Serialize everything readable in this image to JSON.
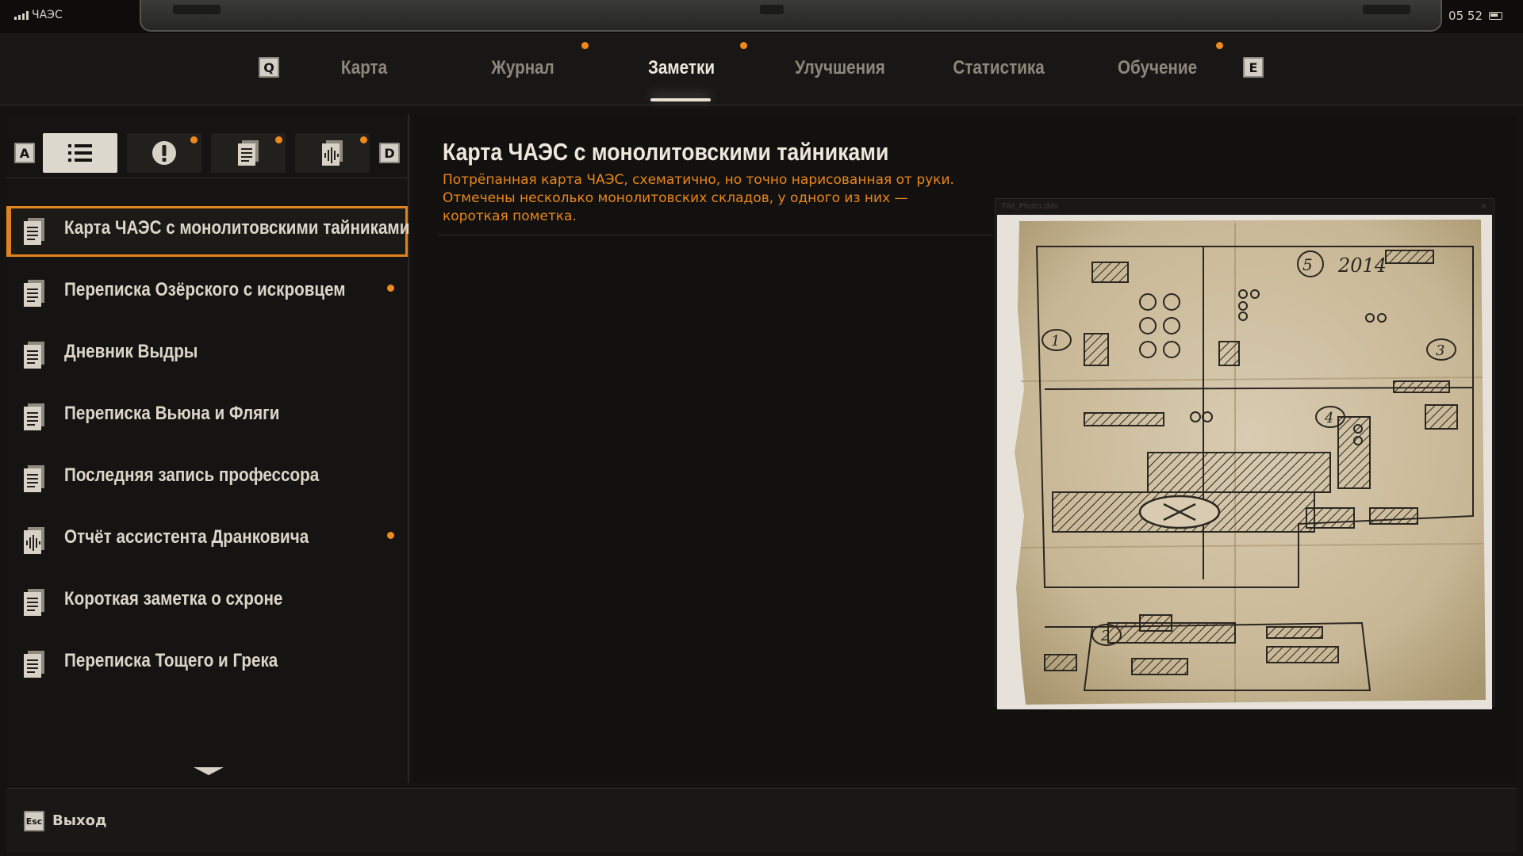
{
  "status": {
    "location": "ЧАЭС",
    "time": "05 52"
  },
  "tabs": {
    "prev_key": "Q",
    "next_key": "E",
    "items": [
      {
        "label": "Карта",
        "active": false,
        "badge": false
      },
      {
        "label": "Журнал",
        "active": false,
        "badge": true
      },
      {
        "label": "Заметки",
        "active": true,
        "badge": true
      },
      {
        "label": "Улучшения",
        "active": false,
        "badge": false
      },
      {
        "label": "Статистика",
        "active": false,
        "badge": false
      },
      {
        "label": "Обучение",
        "active": false,
        "badge": true
      }
    ]
  },
  "filters": {
    "prev_key": "A",
    "next_key": "D",
    "items": [
      {
        "icon": "list-icon",
        "active": true,
        "badge": false
      },
      {
        "icon": "exclamation-icon",
        "active": false,
        "badge": true
      },
      {
        "icon": "document-icon",
        "active": false,
        "badge": true
      },
      {
        "icon": "audio-note-icon",
        "active": false,
        "badge": true
      }
    ]
  },
  "notes": [
    {
      "label": "Карта ЧАЭС с монолитовскими тайниками",
      "icon": "document-icon",
      "selected": true,
      "badge": false
    },
    {
      "label": "Переписка Озёрского с искровцем",
      "icon": "document-icon",
      "selected": false,
      "badge": true
    },
    {
      "label": "Дневник Выдры",
      "icon": "document-icon",
      "selected": false,
      "badge": false
    },
    {
      "label": "Переписка Вьюна и Фляги",
      "icon": "document-icon",
      "selected": false,
      "badge": false
    },
    {
      "label": "Последняя запись профессора",
      "icon": "document-icon",
      "selected": false,
      "badge": false
    },
    {
      "label": "Отчёт ассистента Дранковича",
      "icon": "audio-note-icon",
      "selected": false,
      "badge": true
    },
    {
      "label": "Короткая заметка о схроне",
      "icon": "document-icon",
      "selected": false,
      "badge": false
    },
    {
      "label": "Переписка Тощего и Грека",
      "icon": "document-icon",
      "selected": false,
      "badge": false
    }
  ],
  "detail": {
    "title": "Карта ЧАЭС с монолитовскими тайниками",
    "description": "Потрёпанная карта ЧАЭС, схематично, но точно нарисованная от руки. Отмечены несколько монолитовских складов, у одного из них — короткая пометка.",
    "photo_caption": "File_Photo.dds",
    "map_marks": [
      "5",
      "2014",
      "1",
      "3",
      "4",
      "2"
    ]
  },
  "footer": {
    "exit_key": "Esc",
    "exit_label": "Выход"
  },
  "colors": {
    "accent": "#f0891c",
    "text": "#d8d2c6",
    "background": "#151311"
  }
}
